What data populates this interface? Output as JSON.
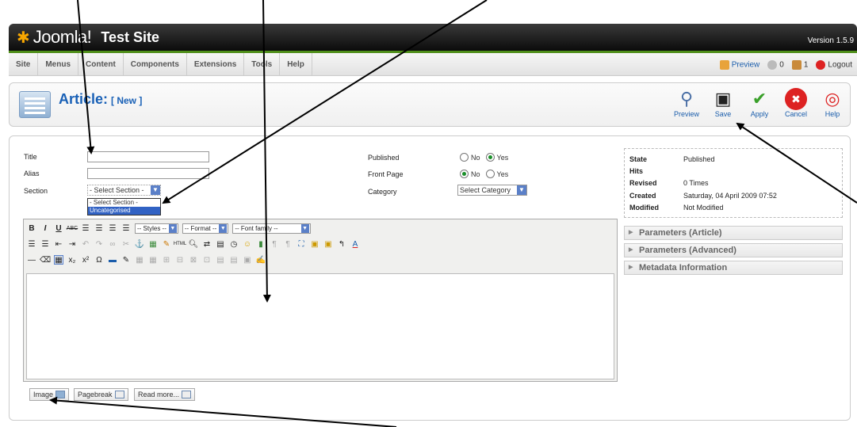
{
  "header": {
    "logo_text": "Joomla!",
    "site_name": "Test Site",
    "version": "Version 1.5.9"
  },
  "menu": {
    "items": [
      "Site",
      "Menus",
      "Content",
      "Components",
      "Extensions",
      "Tools",
      "Help"
    ]
  },
  "status": {
    "preview": "Preview",
    "messages": "0",
    "users": "1",
    "logout": "Logout"
  },
  "page": {
    "title": "Article:",
    "subtitle": "[ New ]"
  },
  "toolbar": {
    "preview": "Preview",
    "save": "Save",
    "apply": "Apply",
    "cancel": "Cancel",
    "help": "Help"
  },
  "form": {
    "title_label": "Title",
    "alias_label": "Alias",
    "section_label": "Section",
    "section_selected": "- Select Section -",
    "section_options": [
      "- Select Section -",
      "Uncategorised"
    ],
    "published_label": "Published",
    "frontpage_label": "Front Page",
    "category_label": "Category",
    "no": "No",
    "yes": "Yes",
    "category_selected": "Select Category"
  },
  "editor": {
    "styles": "-- Styles --",
    "format": "-- Format --",
    "font_family": "-- Font family --"
  },
  "editor_buttons": {
    "image": "Image",
    "pagebreak": "Pagebreak",
    "readmore": "Read more..."
  },
  "info": {
    "state_label": "State",
    "state_value": "Published",
    "hits_label": "Hits",
    "revised_label": "Revised",
    "revised_value": "0 Times",
    "created_label": "Created",
    "created_value": "Saturday, 04 April 2009 07:52",
    "modified_label": "Modified",
    "modified_value": "Not Modified"
  },
  "panels": [
    "Parameters (Article)",
    "Parameters (Advanced)",
    "Metadata Information"
  ],
  "colors": {
    "title_blue": "#1860b6",
    "link_blue": "#1a5dab",
    "header_dark": "#0b0b0b",
    "accent_green": "#4f8f1a"
  }
}
